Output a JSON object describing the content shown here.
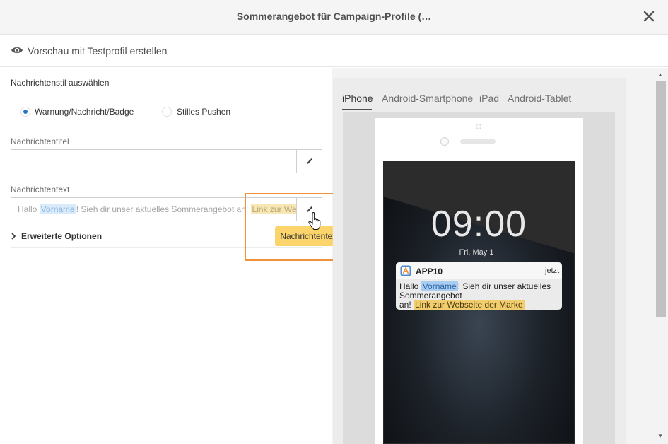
{
  "header": {
    "title": "Sommerangebot für Campaign-Profile (…",
    "close_icon": "close-icon"
  },
  "toolbar": {
    "preview_label": "Vorschau mit Testprofil erstellen",
    "icon": "eye-icon"
  },
  "form": {
    "style_label": "Nachrichtenstil auswählen",
    "radio_options": [
      {
        "label": "Warnung/Nachricht/Badge",
        "selected": true
      },
      {
        "label": "Stilles Pushen",
        "selected": false
      }
    ],
    "title_label": "Nachrichtentitel",
    "title_value": "",
    "text_label": "Nachrichtentext",
    "text_parts": {
      "prefix": "Hallo ",
      "firstname": "Vorname",
      "middle": "! Sieh dir unser aktuelles Sommerangebot an! ",
      "link": "Link zur Webseite der Marke"
    },
    "advanced_label": "Erweiterte Optionen",
    "tooltip": "Nachrichtentext"
  },
  "preview": {
    "tabs": [
      "iPhone",
      "Android-Smartphone",
      "iPad",
      "Android-Tablet"
    ],
    "active_tab": "iPhone",
    "time": "09:00",
    "date": "Fri, May 1",
    "notification": {
      "app_name": "APP10",
      "when": "jetzt",
      "hello": "Hallo ",
      "firstname": "Vorname",
      "line1_rest": "! Sieh dir unser aktuelles",
      "line2": "Sommerangebot",
      "line3_prefix": "an! ",
      "link": "Link zur Webseite der Marke"
    }
  },
  "colors": {
    "accent": "#2c72c4",
    "highlight_border": "#f0923b",
    "tooltip_bg": "#fbd46b",
    "chip_blue": "#d9ebfb",
    "chip_yellow": "#f7e7b4"
  }
}
